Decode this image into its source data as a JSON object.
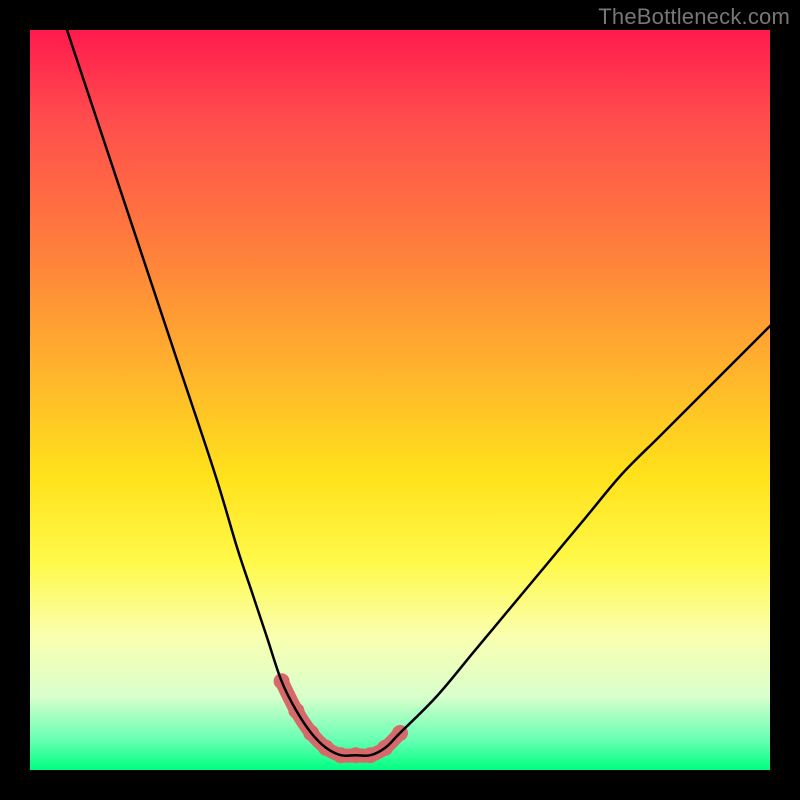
{
  "watermark": "TheBottleneck.com",
  "chart_data": {
    "type": "line",
    "title": "",
    "xlabel": "",
    "ylabel": "",
    "xlim": [
      0,
      100
    ],
    "ylim": [
      0,
      100
    ],
    "grid": false,
    "legend": false,
    "background_gradient": {
      "direction": "vertical",
      "stops": [
        {
          "pos": 0.0,
          "color": "#ff1a4d"
        },
        {
          "pos": 0.12,
          "color": "#ff4d4d"
        },
        {
          "pos": 0.28,
          "color": "#ff7a3d"
        },
        {
          "pos": 0.45,
          "color": "#ffb02e"
        },
        {
          "pos": 0.6,
          "color": "#ffe11a"
        },
        {
          "pos": 0.72,
          "color": "#fff94a"
        },
        {
          "pos": 0.82,
          "color": "#faffb0"
        },
        {
          "pos": 0.9,
          "color": "#d9ffcc"
        },
        {
          "pos": 0.96,
          "color": "#66ffb3"
        },
        {
          "pos": 1.0,
          "color": "#00ff80"
        }
      ]
    },
    "series": [
      {
        "name": "bottleneck-curve",
        "stroke": "#000000",
        "stroke_width": 2.5,
        "x": [
          5,
          10,
          15,
          20,
          25,
          28,
          30,
          32,
          34,
          36,
          38,
          40,
          42,
          44,
          46,
          48,
          50,
          55,
          60,
          65,
          70,
          75,
          80,
          85,
          90,
          95,
          100
        ],
        "y": [
          100,
          85,
          70,
          55,
          40,
          30,
          24,
          18,
          12,
          8,
          5,
          3,
          2,
          2,
          2,
          3,
          5,
          10,
          16,
          22,
          28,
          34,
          40,
          45,
          50,
          55,
          60
        ]
      },
      {
        "name": "valley-emphasis",
        "stroke": "#d66a6a",
        "stroke_width": 14,
        "linecap": "round",
        "x": [
          34,
          36,
          38,
          40,
          42,
          44,
          46,
          48,
          50
        ],
        "y": [
          12,
          8,
          5,
          3,
          2,
          2,
          2,
          3,
          5
        ]
      }
    ],
    "markers": {
      "name": "valley-dots",
      "fill": "#d66a6a",
      "radius": 8,
      "x": [
        34,
        36,
        38,
        40,
        42,
        44,
        46,
        48,
        50
      ],
      "y": [
        12,
        8,
        5,
        3,
        2,
        2,
        2,
        3,
        5
      ]
    }
  }
}
